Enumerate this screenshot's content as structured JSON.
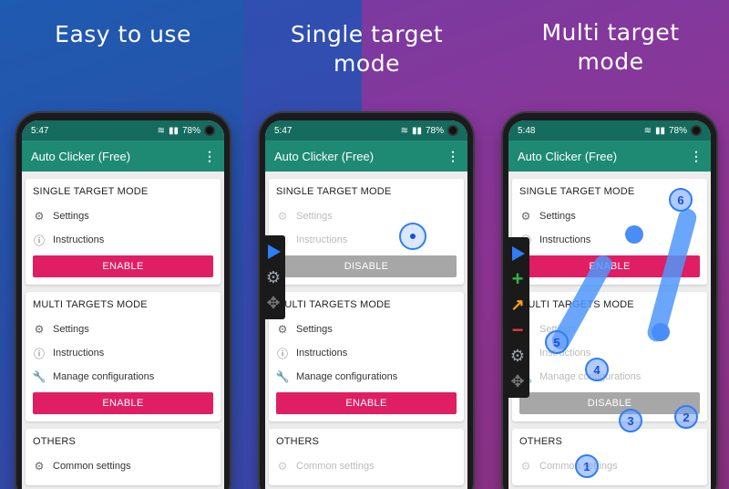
{
  "captions": {
    "c1": "Easy to use",
    "c2_line1": "Single target",
    "c2_line2": "mode",
    "c3_line1": "Multi target",
    "c3_line2": "mode"
  },
  "phones": [
    {
      "time": "5:47",
      "battery": "78%",
      "app_title": "Auto Clicker (Free)",
      "single": {
        "title": "SINGLE TARGET MODE",
        "settings": "Settings",
        "instructions": "Instructions",
        "button": "ENABLE"
      },
      "multi": {
        "title": "MULTI TARGETS MODE",
        "settings": "Settings",
        "instructions": "Instructions",
        "manage": "Manage configurations",
        "button": "ENABLE"
      },
      "others": {
        "title": "OTHERS",
        "common": "Common settings"
      }
    },
    {
      "time": "5:47",
      "battery": "78%",
      "app_title": "Auto Clicker (Free)",
      "single": {
        "title": "SINGLE TARGET MODE",
        "settings": "Settings",
        "instructions": "Instructions",
        "button": "DISABLE"
      },
      "multi": {
        "title": "MULTI TARGETS MODE",
        "settings": "Settings",
        "instructions": "Instructions",
        "manage": "Manage configurations",
        "button": "ENABLE"
      },
      "others": {
        "title": "OTHERS",
        "common": "Common settings"
      }
    },
    {
      "time": "5:48",
      "battery": "78%",
      "app_title": "Auto Clicker (Free)",
      "single": {
        "title": "SINGLE TARGET MODE",
        "settings": "Settings",
        "instructions": "Instructions",
        "button": "ENABLE"
      },
      "multi": {
        "title": "MULTI TARGETS MODE",
        "settings": "Settings",
        "instructions": "Instructions",
        "manage": "Manage configurations",
        "button": "DISABLE"
      },
      "others": {
        "title": "OTHERS",
        "common": "Common settings"
      }
    }
  ],
  "targets": {
    "t1": "1",
    "t2": "2",
    "t3": "3",
    "t4": "4",
    "t5": "5",
    "t6": "6"
  },
  "colors": {
    "appbar": "#1e8a74",
    "statusbar": "#156b5d",
    "enable": "#e01e63",
    "disable": "#a7a7a7"
  }
}
